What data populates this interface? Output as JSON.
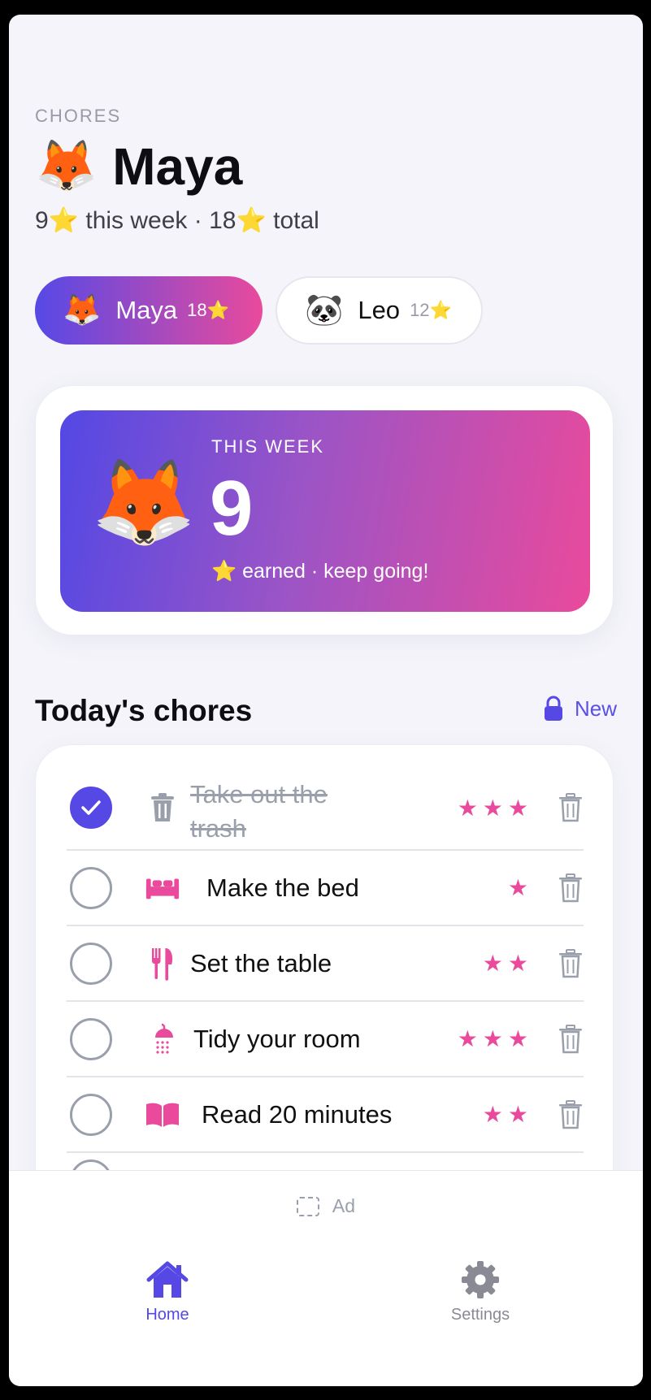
{
  "header": {
    "section_label": "CHORES",
    "kid_emoji": "🦊",
    "kid_name": "Maya",
    "summary": "9⭐ this week · 18⭐ total"
  },
  "kids": [
    {
      "emoji": "🦊",
      "name": "Maya",
      "stars": "18⭐",
      "active": true
    },
    {
      "emoji": "🐼",
      "name": "Leo",
      "stars": "12⭐",
      "active": false
    }
  ],
  "week_card": {
    "emoji": "🦊",
    "label": "THIS WEEK",
    "count": "9",
    "note": "⭐ earned · keep going!"
  },
  "chores_section": {
    "title": "Today's chores",
    "new_label": "New"
  },
  "chores": [
    {
      "name_line1": "Take out the",
      "name_line2": "trash",
      "icon": "trash-icon",
      "stars": "★★★",
      "done": true
    },
    {
      "name": "Make the bed",
      "icon": "bed-icon",
      "stars": "★",
      "done": false
    },
    {
      "name": "Set the table",
      "icon": "fork-knife-icon",
      "stars": "★★",
      "done": false
    },
    {
      "name": "Tidy your room",
      "icon": "shower-icon",
      "stars": "★★★",
      "done": false
    },
    {
      "name": "Read 20 minutes",
      "icon": "book-icon",
      "stars": "★★",
      "done": false
    }
  ],
  "ad": {
    "label": "Ad"
  },
  "nav": {
    "home_label": "Home",
    "settings_label": "Settings"
  },
  "colors": {
    "accent": "#5548e4",
    "pink": "#e94a9c",
    "muted": "#9aa0ab"
  }
}
